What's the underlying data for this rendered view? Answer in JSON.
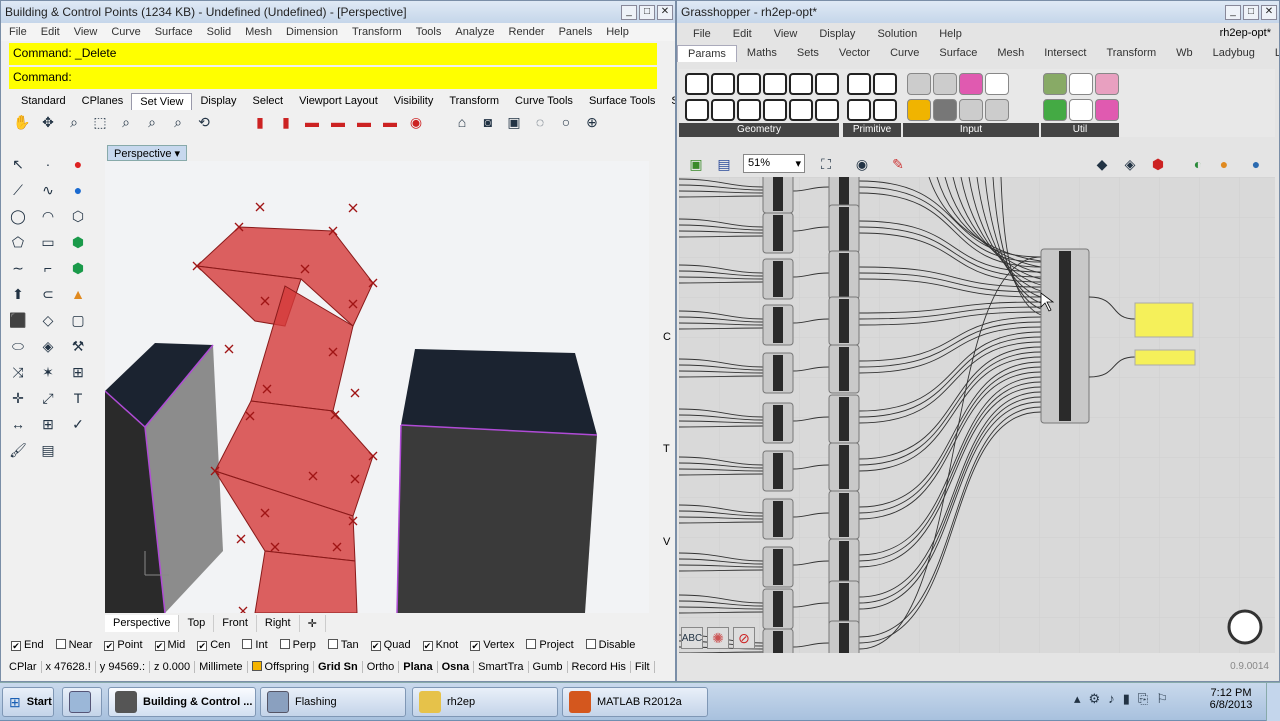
{
  "rhino": {
    "title": "Building & Control Points (1234 KB) - Undefined (Undefined) - [Perspective]",
    "menu": [
      "File",
      "Edit",
      "View",
      "Curve",
      "Surface",
      "Solid",
      "Mesh",
      "Dimension",
      "Transform",
      "Tools",
      "Analyze",
      "Render",
      "Panels",
      "Help"
    ],
    "command_history": "Command: _Delete",
    "command_prompt": "Command:",
    "toolbar_tabs": [
      "Standard",
      "CPlanes",
      "Set View",
      "Display",
      "Select",
      "Viewport Layout",
      "Visibility",
      "Transform",
      "Curve Tools",
      "Surface Tools",
      "S"
    ],
    "active_tab": "Set View",
    "viewport_label": "Perspective",
    "view_tabs": [
      "Perspective",
      "Top",
      "Front",
      "Right"
    ],
    "osnaps": [
      {
        "label": "End",
        "checked": true
      },
      {
        "label": "Near",
        "checked": false
      },
      {
        "label": "Point",
        "checked": true
      },
      {
        "label": "Mid",
        "checked": true
      },
      {
        "label": "Cen",
        "checked": true
      },
      {
        "label": "Int",
        "checked": false
      },
      {
        "label": "Perp",
        "checked": false
      },
      {
        "label": "Tan",
        "checked": false
      },
      {
        "label": "Quad",
        "checked": true
      },
      {
        "label": "Knot",
        "checked": true
      },
      {
        "label": "Vertex",
        "checked": true
      },
      {
        "label": "Project",
        "checked": false
      },
      {
        "label": "Disable",
        "checked": false
      }
    ],
    "status": {
      "cplane": "CPlar",
      "x": "x 47628.!",
      "y": "y 94569.:",
      "z": "z 0.000",
      "units": "Millimete",
      "layer": "Offspring",
      "items": [
        "Grid Sn",
        "Ortho",
        "Plana",
        "Osna",
        "SmartTra",
        "Gumb",
        "Record His",
        "Filt"
      ]
    },
    "side_letters": [
      "C",
      "T",
      "V"
    ]
  },
  "grasshopper": {
    "title": "Grasshopper - rh2ep-opt*",
    "doc_name": "rh2ep-opt*",
    "menu": [
      "File",
      "Edit",
      "View",
      "Display",
      "Solution",
      "Help"
    ],
    "tabs": [
      "Params",
      "Maths",
      "Sets",
      "Vector",
      "Curve",
      "Surface",
      "Mesh",
      "Intersect",
      "Transform",
      "Wb",
      "Ladybug",
      "Lun"
    ],
    "active_tab": "Params",
    "groups": [
      "Geometry",
      "Primitive",
      "Input",
      "Util"
    ],
    "zoom": "51%",
    "version": "0.9.0014"
  },
  "taskbar": {
    "start": "Start",
    "buttons": [
      "Building & Control ...",
      "Flashing",
      "rh2ep",
      "MATLAB  R2012a"
    ],
    "time": "7:12 PM",
    "date": "6/8/2013"
  },
  "colors": {
    "command_bg": "#ffff00",
    "building_red": "#d43a3a",
    "gh_yellow": "#f5f05a",
    "taskbar": "#b8cde5"
  }
}
